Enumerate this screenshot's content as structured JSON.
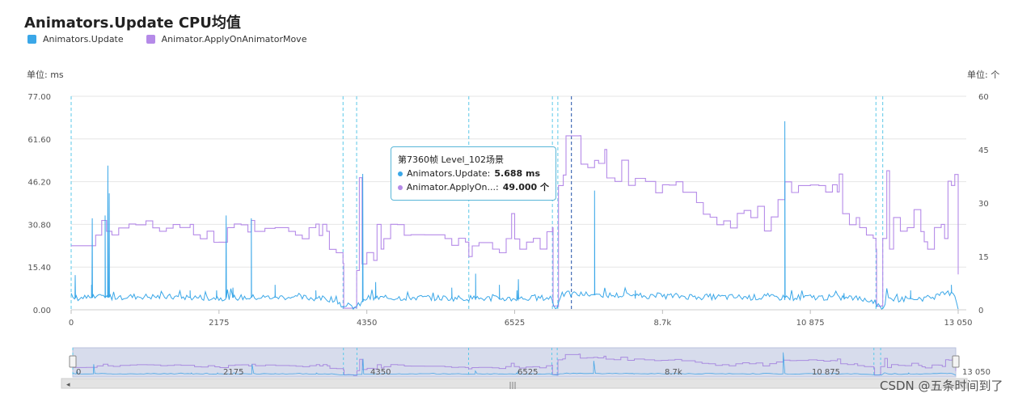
{
  "chart_data": {
    "type": "line",
    "title": "Animators.Update CPU均值",
    "left_unit": "单位: ms",
    "right_unit": "单位: 个",
    "y_left": {
      "ticks": [
        "0.00",
        "15.40",
        "30.80",
        "46.20",
        "61.60",
        "77.00"
      ],
      "min": 0,
      "max": 77
    },
    "y_right": {
      "ticks": [
        "0",
        "15",
        "30",
        "45",
        "60"
      ],
      "min": 0,
      "max": 60
    },
    "x": {
      "min": 0,
      "max": 13050,
      "ticks": [
        {
          "v": 0,
          "label": "0"
        },
        {
          "v": 2175,
          "label": "2175"
        },
        {
          "v": 4350,
          "label": "4350"
        },
        {
          "v": 6525,
          "label": "6525"
        },
        {
          "v": 8700,
          "label": "8.7k"
        },
        {
          "v": 10875,
          "label": "10 875"
        },
        {
          "v": 13050,
          "label": "13 050"
        }
      ]
    },
    "markers": [
      0,
      4000,
      4200,
      5850,
      7080,
      7160,
      11840,
      11940
    ],
    "cursor_x": 7360,
    "series": [
      {
        "name": "Animators.Update",
        "color": "#3aa7e8",
        "axis": "left",
        "baseline": [
          [
            0,
            4.2
          ],
          [
            1000,
            4.8
          ],
          [
            2175,
            4.3
          ],
          [
            3200,
            4.6
          ],
          [
            3900,
            3.8
          ],
          [
            4000,
            1.2
          ],
          [
            4200,
            1.0
          ],
          [
            4350,
            4.2
          ],
          [
            5000,
            4.4
          ],
          [
            6000,
            4.1
          ],
          [
            6525,
            4.0
          ],
          [
            7080,
            4.3
          ],
          [
            7100,
            1.0
          ],
          [
            7160,
            1.0
          ],
          [
            7200,
            5.5
          ],
          [
            7360,
            5.7
          ],
          [
            8000,
            5.2
          ],
          [
            8700,
            5.0
          ],
          [
            9500,
            4.6
          ],
          [
            10500,
            4.4
          ],
          [
            10875,
            4.5
          ],
          [
            11500,
            4.3
          ],
          [
            11840,
            3.0
          ],
          [
            11860,
            1.2
          ],
          [
            11940,
            1.0
          ],
          [
            12000,
            3.8
          ],
          [
            12600,
            4.2
          ],
          [
            12990,
            6.5
          ],
          [
            13050,
            0.3
          ]
        ],
        "spikes": [
          [
            60,
            12.5
          ],
          [
            300,
            9
          ],
          [
            310,
            33
          ],
          [
            500,
            34
          ],
          [
            540,
            52
          ],
          [
            560,
            42
          ],
          [
            1750,
            7
          ],
          [
            2140,
            7
          ],
          [
            2280,
            34
          ],
          [
            2380,
            8
          ],
          [
            2650,
            33
          ],
          [
            3000,
            9
          ],
          [
            3600,
            7
          ],
          [
            4290,
            49
          ],
          [
            4480,
            10
          ],
          [
            5600,
            8
          ],
          [
            5950,
            13
          ],
          [
            6300,
            9
          ],
          [
            6560,
            7
          ],
          [
            6580,
            11
          ],
          [
            7700,
            43
          ],
          [
            8300,
            7
          ],
          [
            10500,
            68
          ],
          [
            11370,
            6
          ],
          [
            12350,
            7
          ],
          [
            12950,
            9
          ]
        ]
      },
      {
        "name": "Animator.ApplyOnAnimatorMove",
        "color": "#b58ae8",
        "axis": "right",
        "points": [
          [
            0,
            18
          ],
          [
            200,
            18
          ],
          [
            360,
            21
          ],
          [
            450,
            25
          ],
          [
            520,
            22
          ],
          [
            600,
            21
          ],
          [
            700,
            23
          ],
          [
            850,
            24
          ],
          [
            950,
            24
          ],
          [
            1100,
            25
          ],
          [
            1200,
            23
          ],
          [
            1300,
            22
          ],
          [
            1400,
            23
          ],
          [
            1500,
            24
          ],
          [
            1600,
            23
          ],
          [
            1750,
            24
          ],
          [
            1800,
            21
          ],
          [
            1900,
            20
          ],
          [
            2000,
            22
          ],
          [
            2100,
            19
          ],
          [
            2175,
            19
          ],
          [
            2300,
            23
          ],
          [
            2400,
            24
          ],
          [
            2500,
            24
          ],
          [
            2600,
            22
          ],
          [
            2650,
            25
          ],
          [
            2700,
            22
          ],
          [
            2850,
            23
          ],
          [
            3000,
            23
          ],
          [
            3200,
            22
          ],
          [
            3300,
            21
          ],
          [
            3400,
            20
          ],
          [
            3500,
            23
          ],
          [
            3600,
            24
          ],
          [
            3650,
            21
          ],
          [
            3700,
            24
          ],
          [
            3760,
            22
          ],
          [
            3800,
            17
          ],
          [
            3900,
            16
          ],
          [
            4000,
            13
          ],
          [
            4010,
            0.5
          ],
          [
            4150,
            0.5
          ],
          [
            4200,
            11
          ],
          [
            4240,
            37
          ],
          [
            4280,
            13
          ],
          [
            4350,
            16
          ],
          [
            4450,
            14
          ],
          [
            4500,
            24
          ],
          [
            4560,
            17
          ],
          [
            4600,
            20
          ],
          [
            4700,
            24
          ],
          [
            4800,
            24
          ],
          [
            4900,
            21
          ],
          [
            5000,
            21
          ],
          [
            5200,
            21
          ],
          [
            5500,
            20
          ],
          [
            5600,
            18
          ],
          [
            5700,
            20
          ],
          [
            5800,
            19
          ],
          [
            5850,
            15
          ],
          [
            5900,
            18
          ],
          [
            6000,
            19
          ],
          [
            6200,
            17
          ],
          [
            6300,
            16
          ],
          [
            6400,
            20
          ],
          [
            6480,
            27
          ],
          [
            6525,
            20
          ],
          [
            6600,
            17
          ],
          [
            6700,
            19
          ],
          [
            6800,
            20
          ],
          [
            6900,
            17
          ],
          [
            7000,
            22
          ],
          [
            7080,
            23
          ],
          [
            7090,
            1
          ],
          [
            7160,
            1
          ],
          [
            7170,
            35
          ],
          [
            7240,
            38
          ],
          [
            7280,
            49
          ],
          [
            7480,
            49
          ],
          [
            7500,
            41
          ],
          [
            7600,
            40
          ],
          [
            7700,
            42
          ],
          [
            7760,
            41
          ],
          [
            7850,
            45
          ],
          [
            7880,
            37
          ],
          [
            8000,
            36
          ],
          [
            8100,
            42
          ],
          [
            8200,
            35
          ],
          [
            8300,
            37
          ],
          [
            8450,
            36
          ],
          [
            8600,
            33
          ],
          [
            8700,
            35
          ],
          [
            8800,
            35
          ],
          [
            8900,
            36
          ],
          [
            9000,
            33
          ],
          [
            9200,
            30
          ],
          [
            9300,
            27
          ],
          [
            9400,
            26
          ],
          [
            9500,
            24
          ],
          [
            9600,
            25
          ],
          [
            9700,
            23
          ],
          [
            9800,
            27
          ],
          [
            9900,
            28
          ],
          [
            10000,
            26
          ],
          [
            10100,
            29
          ],
          [
            10200,
            22
          ],
          [
            10300,
            26
          ],
          [
            10400,
            31
          ],
          [
            10500,
            36
          ],
          [
            10600,
            33
          ],
          [
            10700,
            35
          ],
          [
            10875,
            35
          ],
          [
            11000,
            35
          ],
          [
            11100,
            33
          ],
          [
            11200,
            35
          ],
          [
            11270,
            33
          ],
          [
            11300,
            38
          ],
          [
            11350,
            27
          ],
          [
            11450,
            24
          ],
          [
            11550,
            26
          ],
          [
            11600,
            23
          ],
          [
            11700,
            21
          ],
          [
            11800,
            20
          ],
          [
            11840,
            17
          ],
          [
            11850,
            1
          ],
          [
            11920,
            1
          ],
          [
            11940,
            20
          ],
          [
            12000,
            39
          ],
          [
            12040,
            17
          ],
          [
            12100,
            26
          ],
          [
            12200,
            22
          ],
          [
            12300,
            23
          ],
          [
            12400,
            28
          ],
          [
            12500,
            22
          ],
          [
            12550,
            19
          ],
          [
            12600,
            17
          ],
          [
            12700,
            23
          ],
          [
            12800,
            24
          ],
          [
            12850,
            20
          ],
          [
            12900,
            36
          ],
          [
            12950,
            35
          ],
          [
            13000,
            38
          ],
          [
            13050,
            10
          ]
        ]
      }
    ],
    "tooltip": {
      "header": "第7360帧 Level_102场景",
      "rows": [
        {
          "label": "Animators.Update:",
          "value": "5.688 ms"
        },
        {
          "label": "Animator.ApplyOn...:",
          "value": "49.000 个"
        }
      ]
    },
    "zoom_ticks": [
      "0",
      "2175",
      "4350",
      "6525",
      "8.7k",
      "10 875",
      "13 050"
    ]
  },
  "watermark": "CSDN @五条时间到了"
}
